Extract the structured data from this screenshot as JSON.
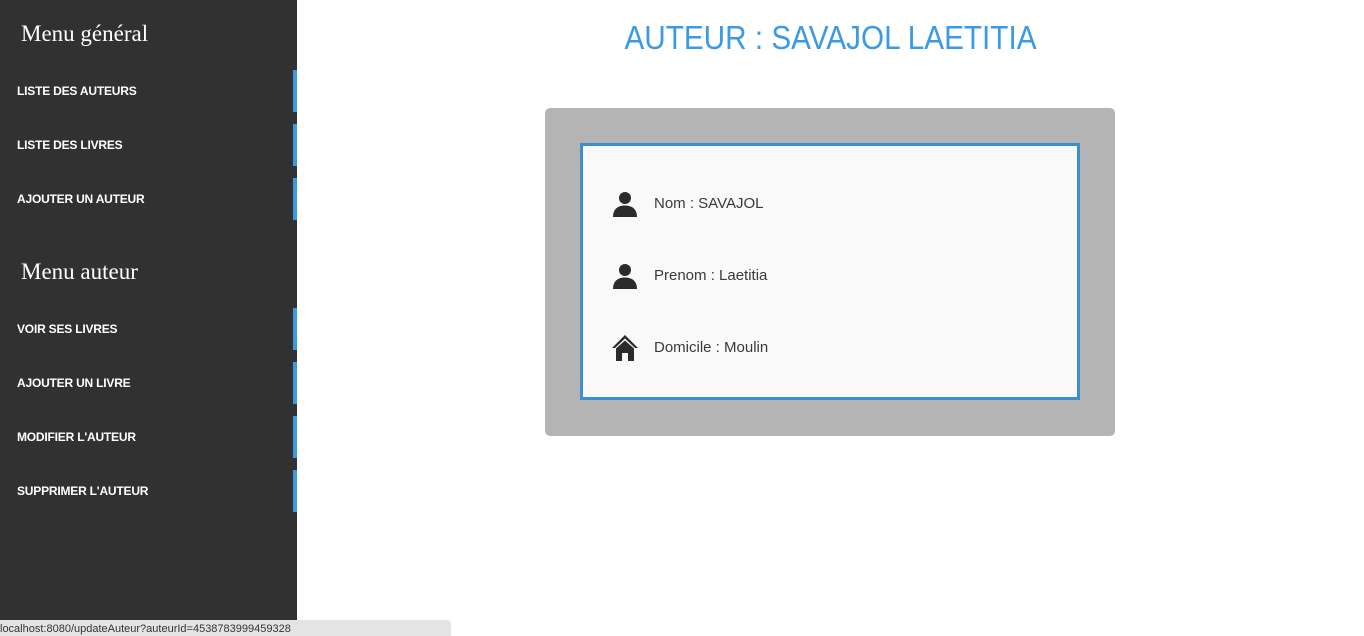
{
  "colors": {
    "sidebar_bg": "#313131",
    "accent": "#3a9ae3",
    "card_bg": "#b4b4b4",
    "card_inner_bg": "#f9f9f9"
  },
  "sidebar": {
    "general_menu": {
      "title": "Menu général",
      "items": [
        {
          "label": "LISTE DES AUTEURS"
        },
        {
          "label": "LISTE DES LIVRES"
        },
        {
          "label": "AJOUTER UN AUTEUR"
        }
      ]
    },
    "author_menu": {
      "title": "Menu auteur",
      "items": [
        {
          "label": "VOIR SES LIVRES"
        },
        {
          "label": "AJOUTER UN LIVRE"
        },
        {
          "label": "MODIFIER L'AUTEUR"
        },
        {
          "label": "SUPPRIMER L'AUTEUR"
        }
      ]
    }
  },
  "main": {
    "title": "AUTEUR : SAVAJOL LAETITIA",
    "details": [
      {
        "icon": "user-icon",
        "text": "Nom : SAVAJOL"
      },
      {
        "icon": "user-icon",
        "text": "Prenom : Laetitia"
      },
      {
        "icon": "home-icon",
        "text": "Domicile : Moulin"
      }
    ]
  },
  "status_bar": {
    "url": "localhost:8080/updateAuteur?auteurId=4538783999459328"
  }
}
